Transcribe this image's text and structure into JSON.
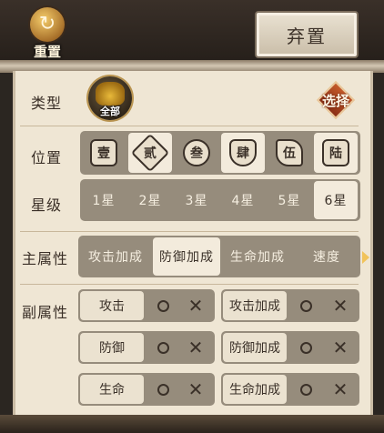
{
  "header": {
    "reset_label": "重置",
    "discard_label": "弃置"
  },
  "filters": {
    "type": {
      "label": "类型",
      "current": "全部",
      "select_label": "选择"
    },
    "position": {
      "label": "位置",
      "options": [
        "壹",
        "贰",
        "叁",
        "肆",
        "伍",
        "陆"
      ],
      "active": [
        false,
        true,
        false,
        true,
        false,
        true
      ]
    },
    "stars": {
      "label": "星级",
      "options": [
        "1星",
        "2星",
        "3星",
        "4星",
        "5星",
        "6星"
      ],
      "selected": "6星"
    },
    "main_attr": {
      "label": "主属性",
      "options": [
        "攻击加成",
        "防御加成",
        "生命加成",
        "速度"
      ],
      "selected": "防御加成"
    },
    "sub_attr": {
      "label": "副属性",
      "rows": [
        {
          "left": "攻击",
          "right": "攻击加成"
        },
        {
          "left": "防御",
          "right": "防御加成"
        },
        {
          "left": "生命",
          "right": "生命加成"
        }
      ]
    }
  },
  "colors": {
    "panel": "#efe6d4",
    "group": "#968c7c",
    "active_cell": "#f3ebdc",
    "text": "#3a3028"
  }
}
